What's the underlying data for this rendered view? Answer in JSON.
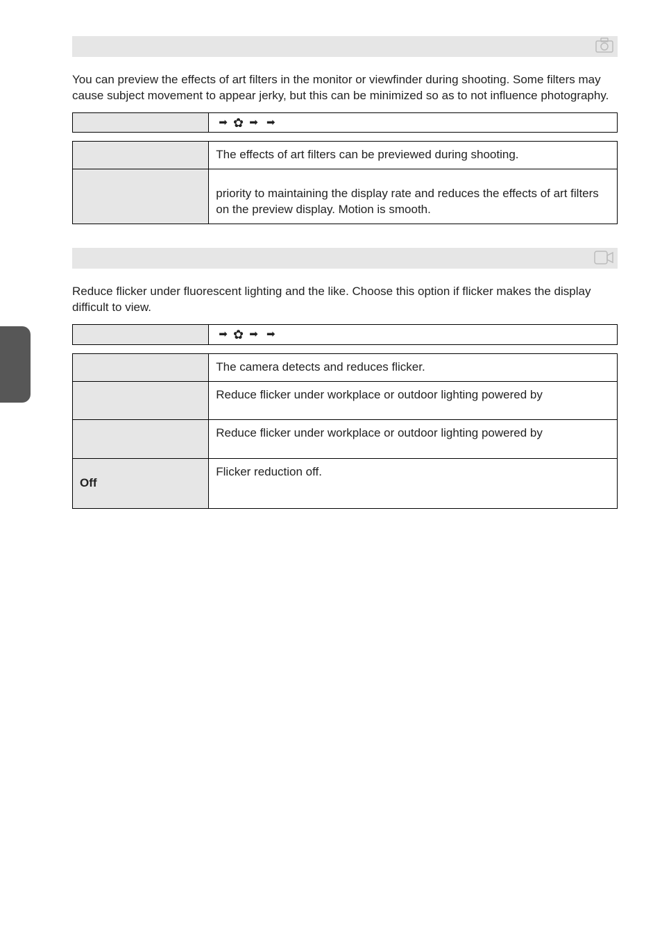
{
  "section1": {
    "intro": "You can preview the effects of art filters in the monitor or viewfinder during shooting. Some filters may cause subject movement to appear jerky, but this can be minimized so as to not influence photography.",
    "menu_left": "",
    "menu_right_1": "",
    "menu_right_2": "",
    "rows": [
      {
        "key": "",
        "desc": "The effects of art filters can be previewed during shooting."
      },
      {
        "key": "",
        "desc": "priority to maintaining the display rate and reduces the effects of art filters on the preview display. Motion is smooth."
      }
    ]
  },
  "section2": {
    "intro": "Reduce flicker under fluorescent lighting and the like. Choose this option if flicker makes the display difficult to view.",
    "menu_left": "",
    "menu_right_1": "",
    "menu_right_2": "",
    "rows": [
      {
        "key": "",
        "desc": "The camera detects and reduces flicker."
      },
      {
        "key": "",
        "desc": "Reduce flicker under workplace or outdoor lighting powered by"
      },
      {
        "key": "",
        "desc": "Reduce flicker under workplace or outdoor lighting powered by"
      },
      {
        "key": "Off",
        "desc": "Flicker reduction off."
      }
    ]
  }
}
